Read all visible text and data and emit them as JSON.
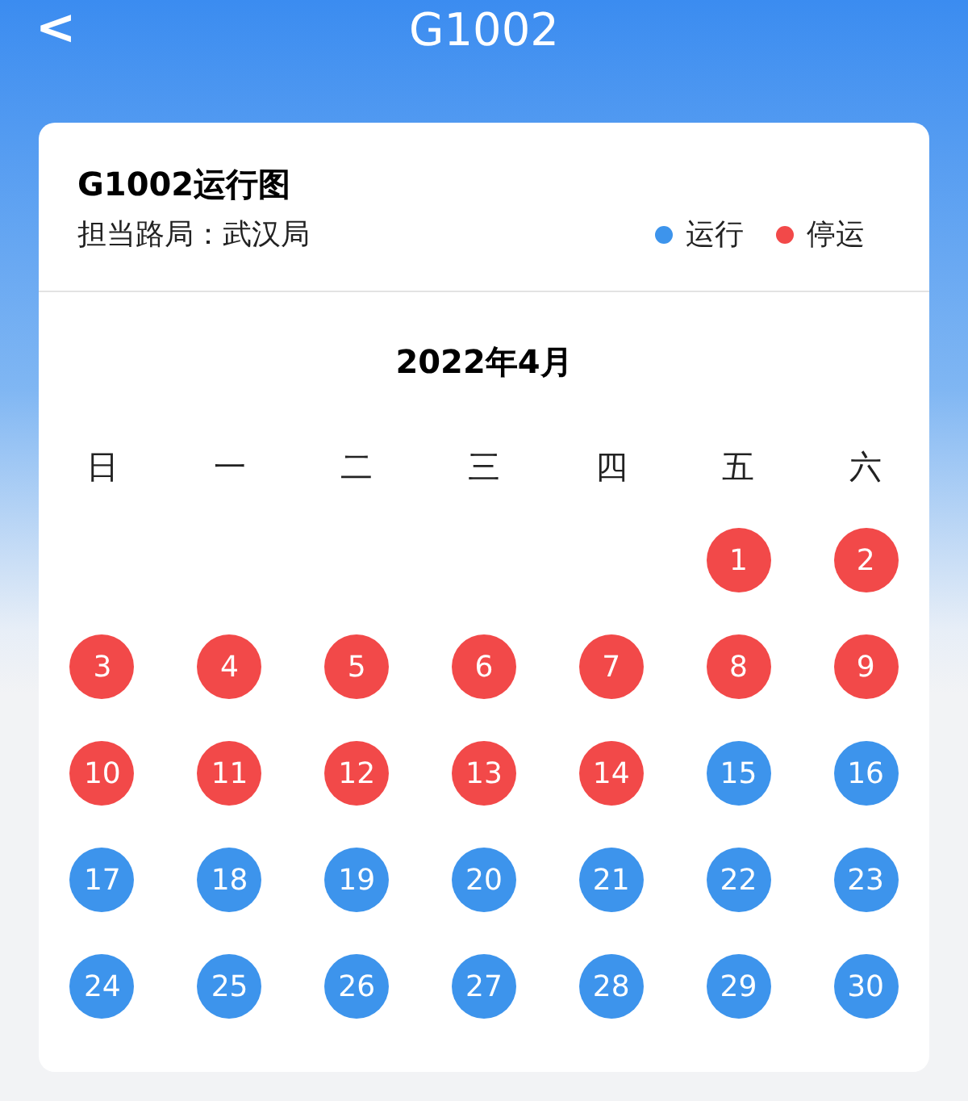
{
  "nav": {
    "back": "<",
    "title": "G1002"
  },
  "card": {
    "title": "G1002运行图",
    "bureau": "担当路局：武汉局",
    "legend": [
      {
        "label": "运行",
        "color": "#3d94ec"
      },
      {
        "label": "停运",
        "color": "#f24949"
      }
    ]
  },
  "calendar": {
    "month": "2022年4月",
    "weekdays": [
      "日",
      "一",
      "二",
      "三",
      "四",
      "五",
      "六"
    ],
    "weeks": [
      [
        {
          "day": "1",
          "color": "#f24949"
        },
        {
          "day": "2",
          "color": "#f24949"
        }
      ],
      [
        {
          "day": "3",
          "color": "#f24949"
        },
        {
          "day": "4",
          "color": "#f24949"
        },
        {
          "day": "5",
          "color": "#f24949"
        },
        {
          "day": "6",
          "color": "#f24949"
        },
        {
          "day": "7",
          "color": "#f24949"
        },
        {
          "day": "8",
          "color": "#f24949"
        },
        {
          "day": "9",
          "color": "#f24949"
        }
      ],
      [
        {
          "day": "10",
          "color": "#f24949"
        },
        {
          "day": "11",
          "color": "#f24949"
        },
        {
          "day": "12",
          "color": "#f24949"
        },
        {
          "day": "13",
          "color": "#f24949"
        },
        {
          "day": "14",
          "color": "#f24949"
        },
        {
          "day": "15",
          "color": "#3d94ec"
        },
        {
          "day": "16",
          "color": "#3d94ec"
        }
      ],
      [
        {
          "day": "17",
          "color": "#3d94ec"
        },
        {
          "day": "18",
          "color": "#3d94ec"
        },
        {
          "day": "19",
          "color": "#3d94ec"
        },
        {
          "day": "20",
          "color": "#3d94ec"
        },
        {
          "day": "21",
          "color": "#3d94ec"
        },
        {
          "day": "22",
          "color": "#3d94ec"
        },
        {
          "day": "23",
          "color": "#3d94ec"
        }
      ],
      [
        {
          "day": "24",
          "color": "#3d94ec"
        },
        {
          "day": "25",
          "color": "#3d94ec"
        },
        {
          "day": "26",
          "color": "#3d94ec"
        },
        {
          "day": "27",
          "color": "#3d94ec"
        },
        {
          "day": "28",
          "color": "#3d94ec"
        },
        {
          "day": "29",
          "color": "#3d94ec"
        },
        {
          "day": "30",
          "color": "#3d94ec"
        }
      ]
    ]
  }
}
